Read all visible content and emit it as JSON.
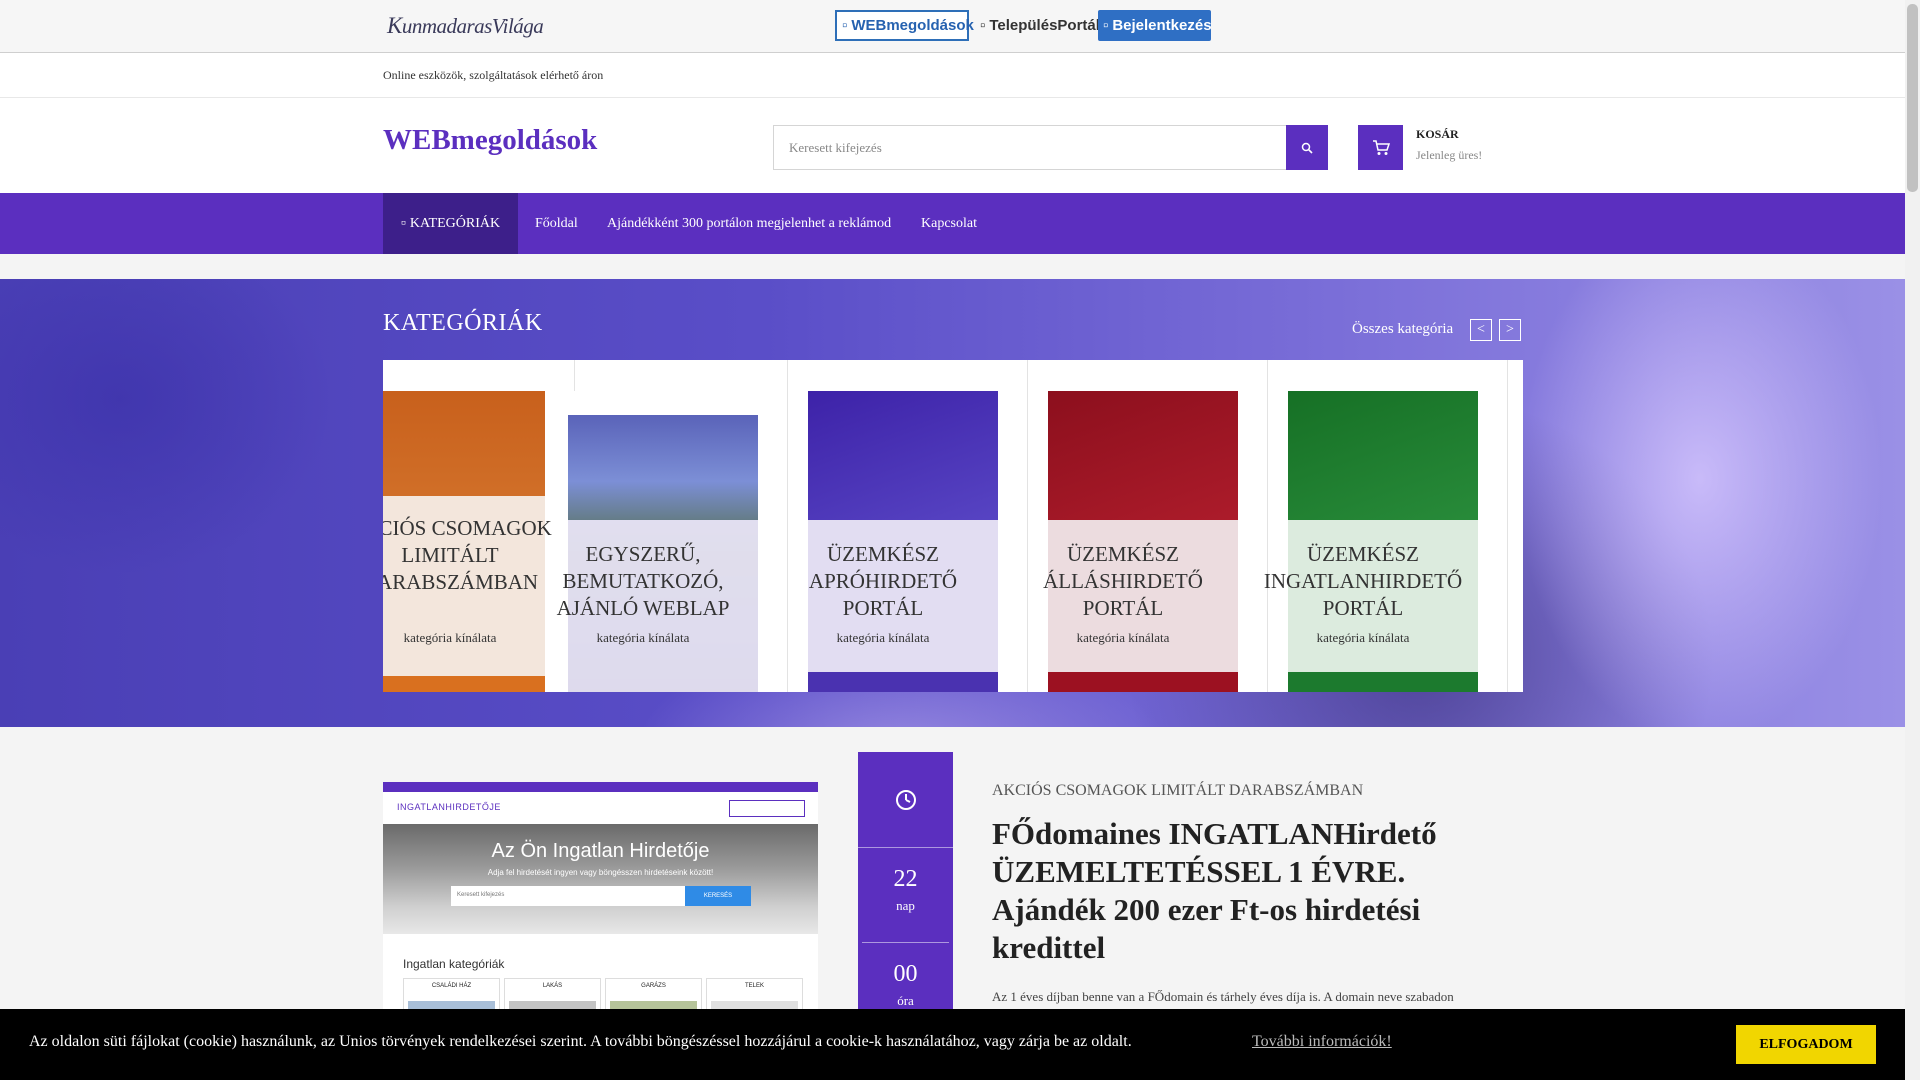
{
  "topbar": {
    "brand_k": "K",
    "brand_rest": "unmadarasVilága",
    "buttons": {
      "web": "WEBmegoldások",
      "telep": "TelepülésPortál",
      "login": "Bejelentkezés"
    }
  },
  "tagline": "Online eszközök, szolgáltatások elérhető áron",
  "header": {
    "logo": "WEBmegoldások",
    "search_placeholder": "Keresett kifejezés",
    "cart_title": "KOSÁR",
    "cart_status": "Jelenleg üres!"
  },
  "nav": {
    "categories": "KATEGÓRIÁK",
    "items": [
      "Főoldal",
      "Ajándékként 300 portálon megjelenhet a reklámod",
      "Kapcsolat"
    ]
  },
  "hero": {
    "title": "KATEGÓRIÁK",
    "all_categories": "Összes kategória",
    "prev": "<",
    "next": ">",
    "cards": [
      {
        "title": "AKCIÓS CSOMAGOK LIMITÁLT DARABSZÁMBAN",
        "sub": "kategória kínálata"
      },
      {
        "title": "EGYSZERŰ, BEMUTATKOZÓ, AJÁNLÓ WEBLAP",
        "sub": "kategória kínálata"
      },
      {
        "title": "ÜZEMKÉSZ APRÓHIRDETŐ PORTÁL",
        "sub": "kategória kínálata"
      },
      {
        "title": "ÜZEMKÉSZ ÁLLÁSHIRDETŐ PORTÁL",
        "sub": "kategória kínálata"
      },
      {
        "title": "ÜZEMKÉSZ INGATLANHIRDETŐ PORTÁL",
        "sub": "kategória kínálata"
      }
    ],
    "colors": {
      "orange": "#d9701f",
      "purple": "#4a32b0",
      "red": "#9c1121",
      "green": "#1c7a2e"
    }
  },
  "promo": {
    "screenshot": {
      "site_title": "INGATLANHIRDETŐJE",
      "hero_text": "Az Ön Ingatlan Hirdetője",
      "hero_sub": "Adja fel hirdetését ingyen vagy böngésszen hirdetéseink között!",
      "search_placeholder": "Keresett kifejezés",
      "search_button": "KERESÉS",
      "section_title": "Ingatlan kategóriák",
      "categories": [
        "CSALÁDI HÁZ",
        "LAKÁS",
        "GARÁZS",
        "TELEK"
      ]
    },
    "countdown": [
      {
        "value": "22",
        "unit": "nap"
      },
      {
        "value": "00",
        "unit": "óra"
      }
    ],
    "category": "AKCIÓS CSOMAGOK LIMITÁLT DARABSZÁMBAN",
    "title": "FŐdomaines INGATLANHirdető ÜZEMELTETÉSSEL 1 ÉVRE. Ajándék 200 ezer Ft-os hirdetési kredittel",
    "description": "Az 1 éves díjban benne van a FŐdomain és tárhely éves díja is. A domain neve szabadon"
  },
  "cookie": {
    "text": "Az oldalon süti fájlokat (cookie) használunk, az Unios törvények rendelkezései szerint. A további böngészéssel hozzájárul a cookie-k használatához, vagy zárja be az oldalt.",
    "link": "További információk!",
    "accept": "ELFOGADOM"
  }
}
